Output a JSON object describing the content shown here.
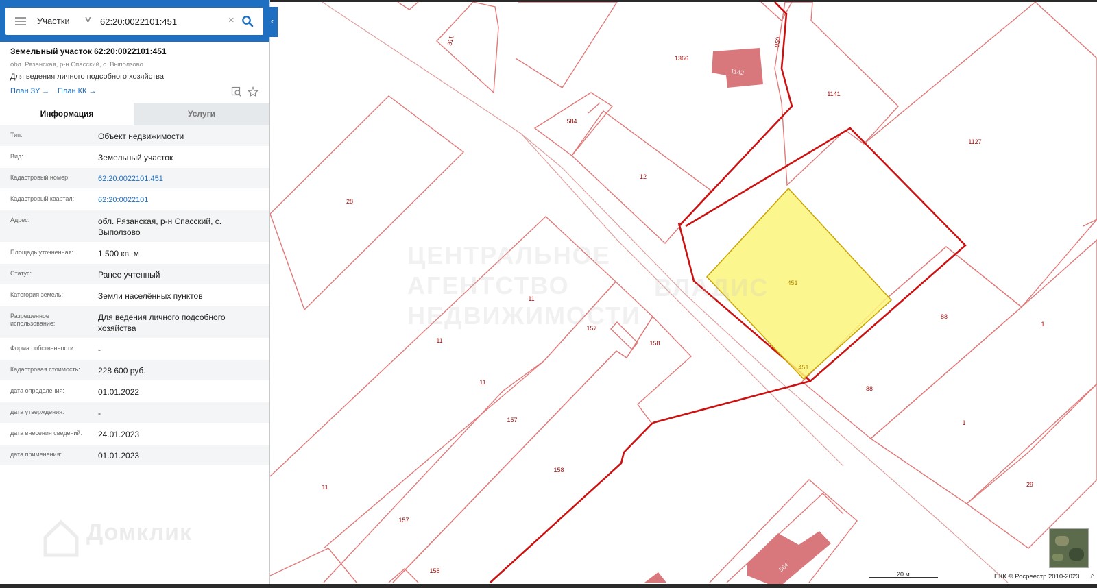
{
  "search": {
    "layer_select": "Участки",
    "query": "62:20:0022101:451"
  },
  "object": {
    "title": "Земельный участок 62:20:0022101:451",
    "address_short": "обл. Рязанская, р-н Спасский, с. Выползово",
    "purpose": "Для ведения личного подсобного хозяйства",
    "link_plan_zu": "План ЗУ →",
    "link_plan_kk": "План КК →"
  },
  "tabs": [
    "Информация",
    "Услуги"
  ],
  "info_rows": [
    {
      "label": "Тип:",
      "value": "Объект недвижимости"
    },
    {
      "label": "Вид:",
      "value": "Земельный участок"
    },
    {
      "label": "Кадастровый номер:",
      "value": "62:20:0022101:451"
    },
    {
      "label": "Кадастровый квартал:",
      "value": "62:20:0022101"
    },
    {
      "label": "Адрес:",
      "value": "обл. Рязанская, р-н Спасский, с. Выползово"
    },
    {
      "label": "Площадь уточненная:",
      "value": "1 500 кв. м"
    },
    {
      "label": "Статус:",
      "value": "Ранее учтенный"
    },
    {
      "label": "Категория земель:",
      "value": "Земли населённых пунктов"
    },
    {
      "label": "Разрешенное использование:",
      "value": "Для ведения личного подсобного хозяйства"
    },
    {
      "label": "Форма собственности:",
      "value": "-"
    },
    {
      "label": "Кадастровая стоимость:",
      "value": "228 600 руб."
    },
    {
      "label": "дата определения:",
      "value": "01.01.2022"
    },
    {
      "label": "дата утверждения:",
      "value": "-"
    },
    {
      "label": "дата внесения сведений:",
      "value": "24.01.2023"
    },
    {
      "label": "дата применения:",
      "value": "01.01.2023"
    }
  ],
  "map": {
    "parcel_labels": [
      "311",
      "1366",
      "1142",
      "950",
      "1141",
      "584",
      "1127",
      "12",
      "28",
      "451",
      "451",
      "88",
      "88",
      "11",
      "11",
      "11",
      "11",
      "157",
      "157",
      "157",
      "158",
      "158",
      "158",
      "1",
      "1",
      "29",
      "564"
    ],
    "scale_label": "20 м",
    "copyright": "ПКК © Росреестр 2010-2023"
  },
  "watermarks": {
    "domclick": "Домклик",
    "agency": "ЦЕНТРАЛЬНОЕ АГЕНТСТВО НЕДВИЖИМОСТИ",
    "vladis": "ВЛАДИС"
  },
  "colors": {
    "accent": "#1e6fc2",
    "parcel_line": "#e07a7a",
    "parcel_bold": "#cc1111",
    "selected_fill": "#fbf47a",
    "building": "#d9787c"
  },
  "icons": [
    "menu-icon",
    "chevron-down-icon",
    "clear-icon",
    "search-icon",
    "collapse-arrow-icon",
    "zoom-to-icon",
    "star-icon",
    "home-icon"
  ]
}
